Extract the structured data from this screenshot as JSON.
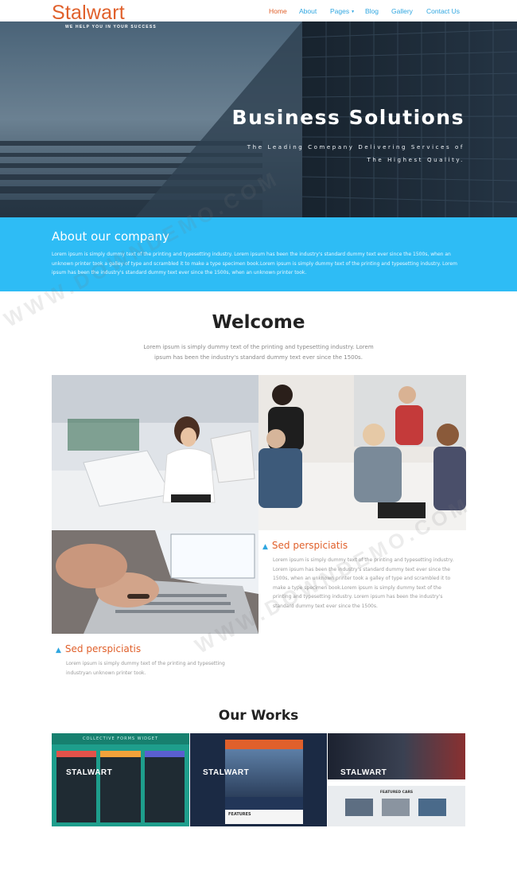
{
  "brand": {
    "logo": "Stalwart",
    "tagline": "WE HELP YOU IN YOUR SUCCESS",
    "accent": "#e0602b",
    "link_color": "#2fa6e0"
  },
  "nav": {
    "items": [
      {
        "label": "Home",
        "active": true
      },
      {
        "label": "About"
      },
      {
        "label": "Pages"
      },
      {
        "label": "Blog"
      },
      {
        "label": "Gallery"
      },
      {
        "label": "Contact Us"
      }
    ]
  },
  "hero": {
    "title": "Business Solutions",
    "subtitle": "The Leading Comepany Delivering Services of The Highest Quality."
  },
  "about": {
    "heading": "About our company",
    "text": "Lorem ipsum is simply dummy text of the printing and typesetting industry. Lorem ipsum has been the industry's standard dummy text ever since the 1500s, when an unknown printer took a galley of type and scrambled it to make a type specimen book.Lorem ipsum is simply dummy text of the printing and typesetting industry. Lorem ipsum has been the industry's standard dummy text ever since the 1500s, when an unknown printer took.",
    "bg": "#2ebcf5"
  },
  "welcome": {
    "title": "Welcome",
    "text": "Lorem ipsum is simply dummy text of the printing and typesetting industry. Lorem ipsum has been the industry's standard dummy text ever since the 1500s."
  },
  "features": [
    {
      "title": "Sed perspiciatis",
      "text": "Lorem ipsum is simply dummy text of the printing and typesetting industry. Lorem ipsum has been the industry's standard dummy text ever since the 1500s, when an unknown printer took a galley of type and scrambled it to make a type specimen book.Lorem ipsum is simply dummy text of the printing and typesetting industry. Lorem ipsum has been the industry's standard dummy text ever since the 1500s."
    },
    {
      "title": "Sed perspiciatis",
      "text": "Lorem ipsum is simply dummy text of the printing and typesetting industryan unknown printer took."
    }
  ],
  "works": {
    "title": "Our Works",
    "items": [
      {
        "brand": "STALWART",
        "banner": "COLLECTIVE FORMS WIDGET",
        "color": "#1e9e8c"
      },
      {
        "brand": "STALWART",
        "banner": "FEATURES",
        "color": "#1b2a44"
      },
      {
        "brand": "STALWART",
        "banner": "FEATURED CARS",
        "color": "#e9ecef"
      }
    ]
  },
  "watermark": "WWW.DOWNDEMO.COM"
}
